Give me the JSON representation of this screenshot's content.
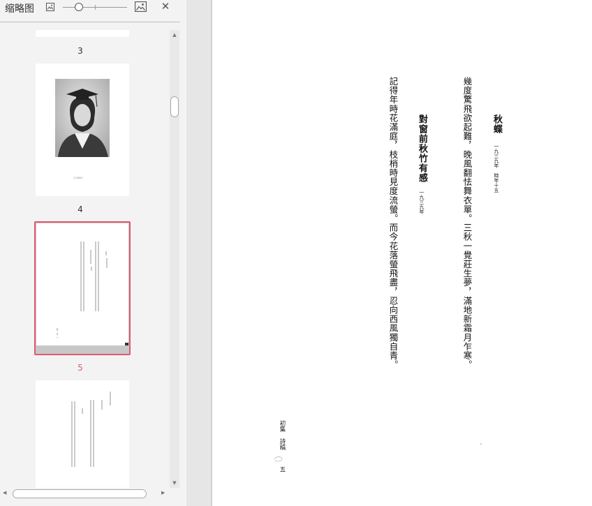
{
  "sidebar": {
    "title": "缩略图",
    "icons": {
      "shrink": "image-small-icon",
      "enlarge": "image-large-icon",
      "close": "close-icon"
    },
    "zoom_slider_level": 0.25,
    "pages": [
      {
        "label": "3"
      },
      {
        "label": "4"
      },
      {
        "label": "5",
        "active": true
      }
    ],
    "accent_color": "#e05a6c",
    "thumb_photo_caption": "（大學時代）"
  },
  "page": {
    "poem1": {
      "title": "秋蝶",
      "subtitle": "一九三九年　時年十五",
      "text": "幾度驚飛欲起難，晚風翻怯舞衣單。三秋一覺莊生夢，滿地新霜月乍寒。"
    },
    "poem2": {
      "title": "對窗前秋竹有感",
      "subtitle": "一九三九年",
      "text": "記得年時花滿庭，枝梢時見度流螢。而今花落螢飛盡，忍向西風獨自青。"
    },
    "footer": {
      "collection": "初集",
      "section": "詩稿",
      "page_number": "五"
    }
  }
}
